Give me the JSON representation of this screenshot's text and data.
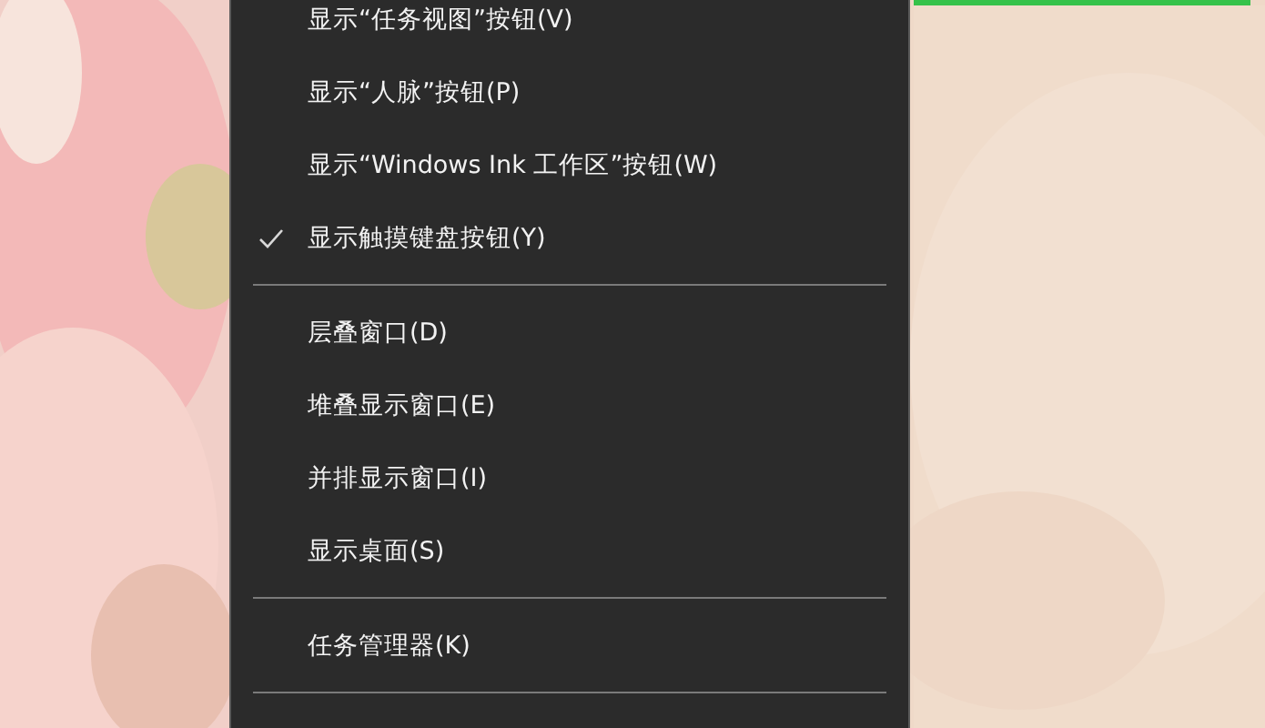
{
  "context_menu": {
    "items": [
      {
        "kind": "item",
        "label": "显示“任务视图”按钮(V)",
        "checked": false
      },
      {
        "kind": "item",
        "label": "显示“人脉”按钮(P)",
        "checked": false
      },
      {
        "kind": "item",
        "label": "显示“Windows Ink 工作区”按钮(W)",
        "checked": false
      },
      {
        "kind": "item",
        "label": "显示触摸键盘按钮(Y)",
        "checked": true
      },
      {
        "kind": "separator"
      },
      {
        "kind": "item",
        "label": "层叠窗口(D)",
        "checked": false
      },
      {
        "kind": "item",
        "label": "堆叠显示窗口(E)",
        "checked": false
      },
      {
        "kind": "item",
        "label": "并排显示窗口(I)",
        "checked": false
      },
      {
        "kind": "item",
        "label": "显示桌面(S)",
        "checked": false
      },
      {
        "kind": "separator"
      },
      {
        "kind": "item",
        "label": "任务管理器(K)",
        "checked": false
      },
      {
        "kind": "separator"
      }
    ]
  }
}
